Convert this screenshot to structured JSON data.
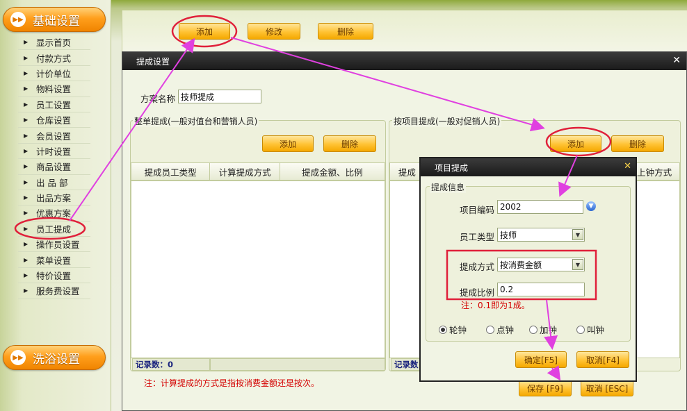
{
  "sidebar": {
    "section_basic": "基础设置",
    "section_bath": "洗浴设置",
    "items": [
      "显示首页",
      "付款方式",
      "计价单位",
      "物料设置",
      "员工设置",
      "仓库设置",
      "会员设置",
      "计时设置",
      "商品设置",
      "出 品 部",
      "出品方案",
      "优惠方案",
      "员工提成",
      "操作员设置",
      "菜单设置",
      "特价设置",
      "服务费设置"
    ]
  },
  "toolbar": {
    "add": "添加",
    "edit": "修改",
    "delete": "删除"
  },
  "dialog": {
    "title": "提成设置",
    "close": "✕",
    "scheme_label": "方案名称",
    "scheme_value": "技师提成",
    "left": {
      "legend": "整单提成(一般对值台和营销人员)",
      "add": "添加",
      "delete": "删除",
      "columns": [
        "提成员工类型",
        "计算提成方式",
        "提成金额、比例"
      ],
      "records": "记录数：0"
    },
    "right": {
      "legend": "按项目提成(一般对促销人员)",
      "add": "添加",
      "delete": "删除",
      "col_first": "提成",
      "col_last": "上钟方式",
      "records": "记录数："
    },
    "note": "注：计算提成的方式是指按消费金额还是按次。",
    "save": "保存 [F9]",
    "cancel": "取消 [ESC]"
  },
  "subdialog": {
    "title": "项目提成",
    "close": "✕",
    "legend": "提成信息",
    "code_label": "项目编码",
    "code_value": "2002",
    "type_label": "员工类型",
    "type_value": "技师",
    "method_label": "提成方式",
    "method_value": "按消费金额",
    "ratio_label": "提成比例",
    "ratio_value": "0.2",
    "note": "注：0.1即为1成。",
    "radios": [
      "轮钟",
      "点钟",
      "加钟",
      "叫钟"
    ],
    "selected_radio": "轮钟",
    "ok": "确定[F5]",
    "cancel": "取消[F4]"
  },
  "colors": {
    "accent_orange": "#ff9f1c",
    "annotation_red": "#e0203a",
    "annotation_magenta": "#e040e0"
  }
}
